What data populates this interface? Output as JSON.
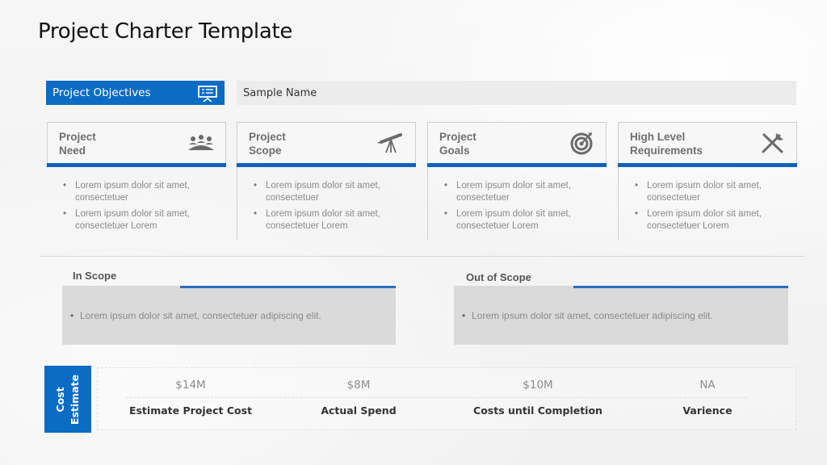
{
  "title": "Project Charter Template",
  "objectives": {
    "label": "Project Objectives",
    "icon": "presentation-board-icon",
    "value": "Sample Name"
  },
  "cards": [
    {
      "title": "Project\nNeed",
      "icon": "team-meeting-icon",
      "bullets": [
        "Lorem ipsum dolor sit amet, consectetuer",
        "Lorem ipsum dolor sit amet, consectetuer Lorem"
      ]
    },
    {
      "title": "Project\nScope",
      "icon": "telescope-icon",
      "bullets": [
        "Lorem ipsum dolor sit amet, consectetuer",
        "Lorem ipsum dolor sit amet, consectetuer Lorem"
      ]
    },
    {
      "title": "Project\nGoals",
      "icon": "target-icon",
      "bullets": [
        "Lorem ipsum dolor sit amet, consectetuer",
        "Lorem ipsum dolor sit amet, consectetuer Lorem"
      ]
    },
    {
      "title": "High Level\nRequirements",
      "icon": "tools-icon",
      "bullets": [
        "Lorem ipsum dolor sit amet, consectetuer",
        "Lorem ipsum dolor sit amet, consectetuer Lorem"
      ]
    }
  ],
  "in_scope": {
    "title": "In Scope",
    "text": "Lorem ipsum dolor sit amet, consectetuer  adipiscing elit."
  },
  "out_of_scope": {
    "title": "Out of Scope",
    "text": "Lorem ipsum dolor sit amet, consectetuer  adipiscing elit."
  },
  "cost": {
    "label": "Cost\nEstimate",
    "items": [
      {
        "value": "$14M",
        "name": "Estimate Project Cost"
      },
      {
        "value": "$8M",
        "name": "Actual Spend"
      },
      {
        "value": "$10M",
        "name": "Costs until Completion"
      },
      {
        "value": "NA",
        "name": "Varience"
      }
    ]
  },
  "colors": {
    "accent": "#0b6cc4",
    "accent_bar": "#0b63b8",
    "scope_box": "#dadada"
  }
}
